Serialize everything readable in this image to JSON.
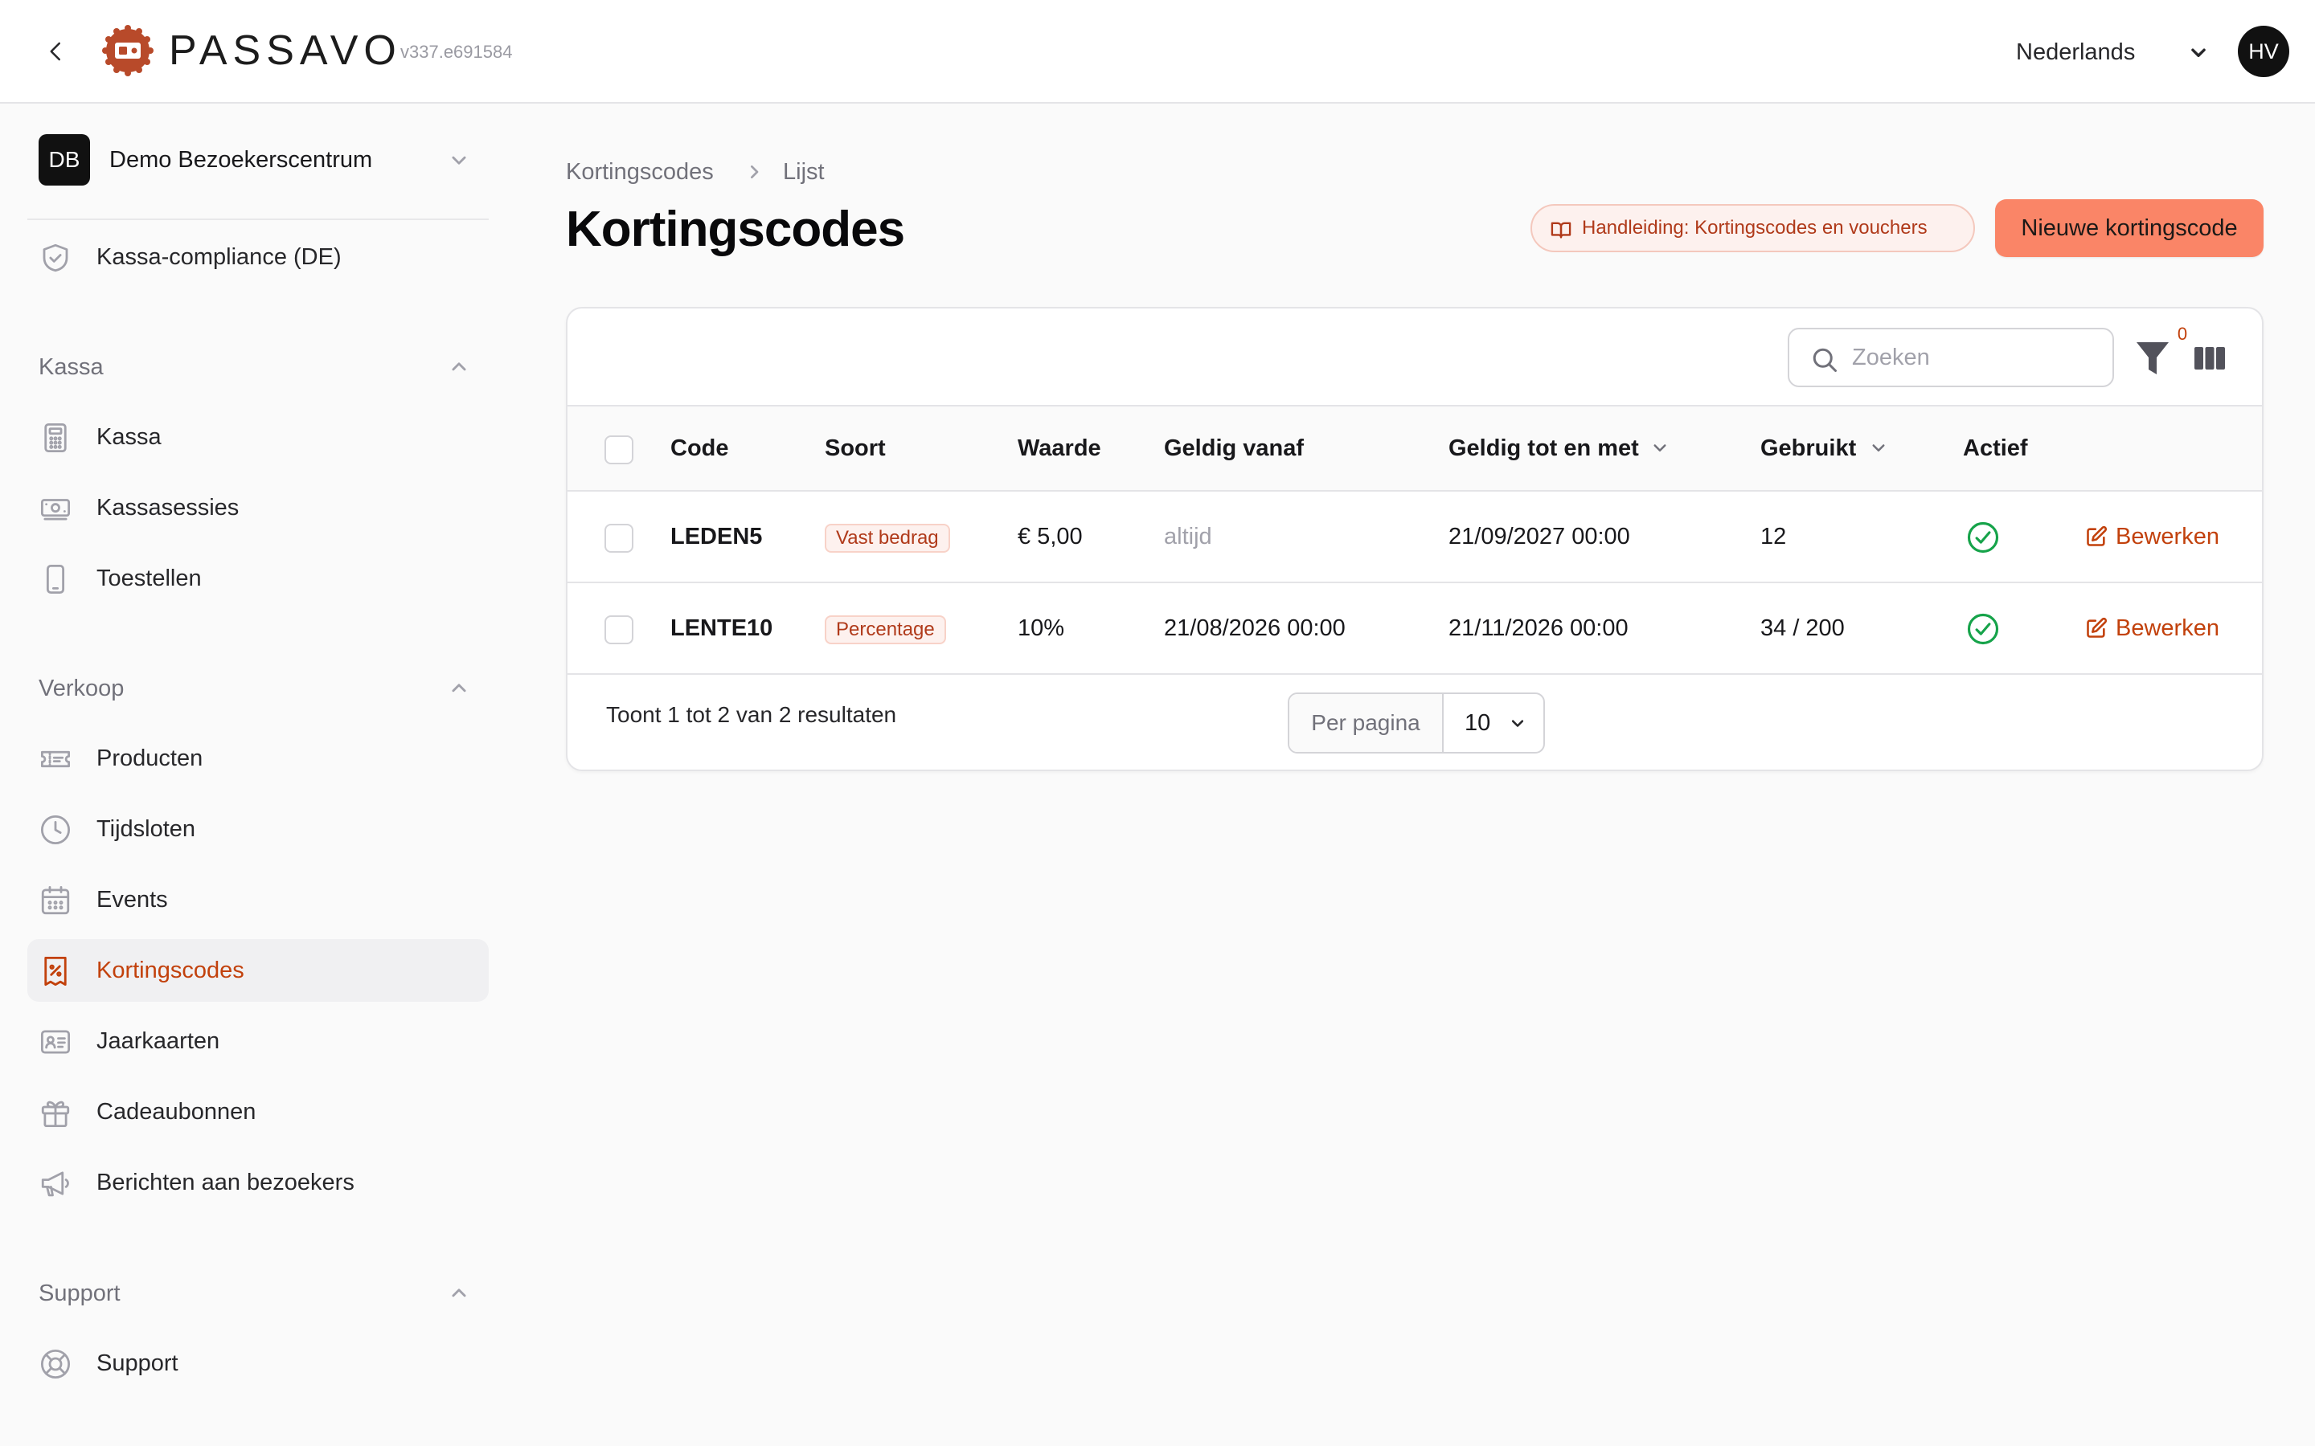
{
  "header": {
    "brand": "PASSAVO",
    "version": "v337.e691584",
    "language": "Nederlands",
    "user_initials": "HV"
  },
  "sidebar": {
    "org": {
      "initials": "DB",
      "name": "Demo Bezoekerscentrum"
    },
    "top_items": [
      {
        "label": "Kassa-compliance (DE)",
        "icon": "shield-check-icon"
      }
    ],
    "sections": [
      {
        "label": "Kassa",
        "items": [
          {
            "label": "Kassa",
            "icon": "calculator-icon"
          },
          {
            "label": "Kassasessies",
            "icon": "cash-icon"
          },
          {
            "label": "Toestellen",
            "icon": "phone-icon"
          }
        ]
      },
      {
        "label": "Verkoop",
        "items": [
          {
            "label": "Producten",
            "icon": "ticket-icon"
          },
          {
            "label": "Tijdsloten",
            "icon": "clock-icon"
          },
          {
            "label": "Events",
            "icon": "calendar-icon"
          },
          {
            "label": "Kortingscodes",
            "icon": "discount-receipt-icon",
            "active": true
          },
          {
            "label": "Jaarkaarten",
            "icon": "id-card-icon"
          },
          {
            "label": "Cadeaubonnen",
            "icon": "gift-icon"
          },
          {
            "label": "Berichten aan bezoekers",
            "icon": "megaphone-icon"
          }
        ]
      },
      {
        "label": "Support",
        "items": [
          {
            "label": "Support",
            "icon": "lifebuoy-icon"
          }
        ]
      }
    ]
  },
  "breadcrumb": [
    "Kortingscodes",
    "Lijst"
  ],
  "page": {
    "title": "Kortingscodes",
    "guide_label": "Handleiding: Kortingscodes en vouchers",
    "new_button": "Nieuwe kortingscode"
  },
  "table": {
    "search_placeholder": "Zoeken",
    "filter_count": "0",
    "columns": {
      "code": "Code",
      "type": "Soort",
      "value": "Waarde",
      "valid_from": "Geldig vanaf",
      "valid_until": "Geldig tot en met",
      "used": "Gebruikt",
      "active": "Actief"
    },
    "rows": [
      {
        "code": "LEDEN5",
        "type": "Vast bedrag",
        "value": "€ 5,00",
        "valid_from": "altijd",
        "valid_until": "21/09/2027 00:00",
        "used": "12",
        "active": true,
        "edit": "Bewerken"
      },
      {
        "code": "LENTE10",
        "type": "Percentage",
        "value": "10%",
        "valid_from": "21/08/2026 00:00",
        "valid_until": "21/11/2026 00:00",
        "used": "34 / 200",
        "active": true,
        "edit": "Bewerken"
      }
    ],
    "results_text": "Toont 1 tot 2 van 2 resultaten",
    "per_page_label": "Per pagina",
    "per_page_value": "10"
  },
  "colors": {
    "accent": "#fa8567",
    "accent_text": "#c2410c",
    "success": "#16a34a",
    "logo": "#b84a2a"
  }
}
